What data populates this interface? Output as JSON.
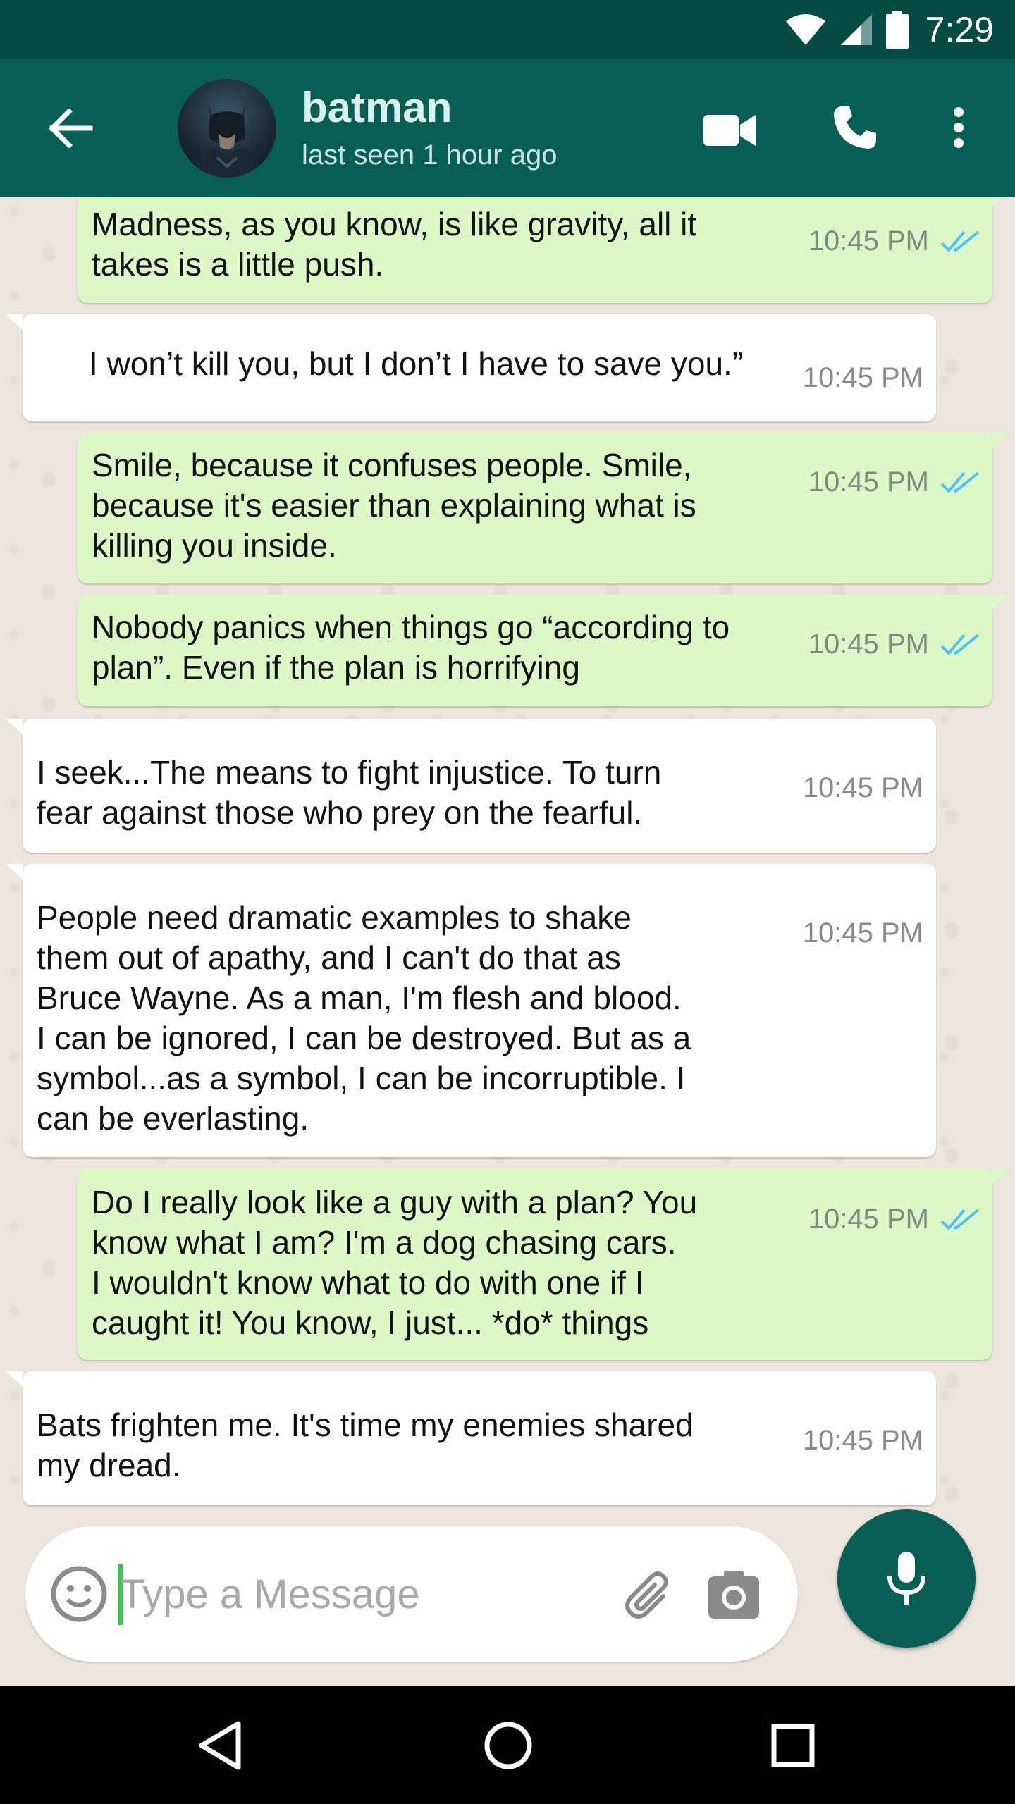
{
  "status_bar": {
    "time": "7:29"
  },
  "header": {
    "contact_name": "batman",
    "contact_status": "last seen 1 hour ago"
  },
  "messages": [
    {
      "direction": "out",
      "text": "Madness, as you know, is like gravity, all it\ntakes is a little push.",
      "time": "10:45 PM",
      "ticks": "read"
    },
    {
      "direction": "in",
      "text": "I won’t kill you, but I don’t I have to save you.”",
      "time": "10:45 PM"
    },
    {
      "direction": "out",
      "text": "Smile, because it confuses people. Smile,\nbecause it's easier than explaining what is\nkilling you inside.",
      "time": "10:45 PM",
      "ticks": "read"
    },
    {
      "direction": "out",
      "text": "Nobody panics when things go “according to\nplan”. Even if the plan is horrifying",
      "time": "10:45 PM",
      "ticks": "read"
    },
    {
      "direction": "in",
      "text": "I seek...The means to fight injustice. To turn\nfear against those who prey on the fearful.",
      "time": "10:45 PM"
    },
    {
      "direction": "in",
      "text": "People need dramatic examples to shake\nthem out of apathy, and I can't do that as\nBruce Wayne. As a man, I'm flesh and blood.\nI can be ignored, I can be destroyed. But as a\nsymbol...as a symbol, I can be incorruptible. I\ncan be everlasting.",
      "time": "10:45 PM"
    },
    {
      "direction": "out",
      "text": "Do I really look like a guy with a plan? You\nknow what I am? I'm a dog chasing cars.\nI wouldn't know what to do with one if I\ncaught it! You know, I just... *do* things",
      "time": "10:45 PM",
      "ticks": "read"
    },
    {
      "direction": "in",
      "text": "Bats frighten me. It's time my enemies shared\nmy dread.",
      "time": "10:45 PM"
    }
  ],
  "composer": {
    "placeholder": "Type a Message",
    "value": ""
  },
  "colors": {
    "header": "#075e54",
    "status_bar": "#054d44",
    "outgoing_bubble": "#dcf8c6",
    "incoming_bubble": "#ffffff",
    "read_ticks": "#4fc3f7",
    "chat_background": "#ece5dd"
  },
  "icons": {
    "back": "arrow-left-icon",
    "video": "video-camera-icon",
    "call": "phone-icon",
    "menu": "more-vertical-icon",
    "emoji": "smiley-icon",
    "attach": "paperclip-icon",
    "camera": "camera-icon",
    "mic": "microphone-icon"
  }
}
